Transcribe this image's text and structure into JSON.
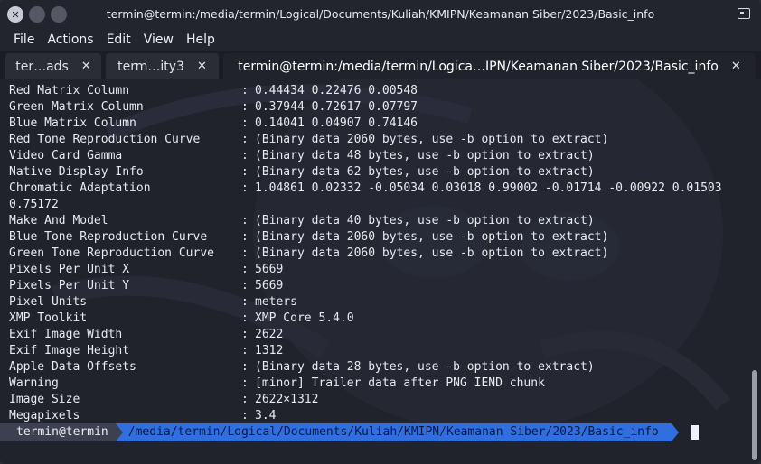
{
  "window": {
    "title": "termin@termin:/media/termin/Logical/Documents/Kuliah/KMIPN/Keamanan Siber/2023/Basic_info"
  },
  "menu": [
    "File",
    "Actions",
    "Edit",
    "View",
    "Help"
  ],
  "tabs": [
    {
      "label": "ter…ads",
      "close": "✕"
    },
    {
      "label": "term…ity3",
      "close": "✕"
    },
    {
      "label": "termin@termin:/media/termin/Logica…IPN/Keamanan Siber/2023/Basic_info",
      "close": "✕"
    }
  ],
  "output": [
    {
      "key": "Red Matrix Column",
      "value": "0.44434 0.22476 0.00548"
    },
    {
      "key": "Green Matrix Column",
      "value": "0.37944 0.72617 0.07797"
    },
    {
      "key": "Blue Matrix Column",
      "value": "0.14041 0.04907 0.74146"
    },
    {
      "key": "Red Tone Reproduction Curve",
      "value": "(Binary data 2060 bytes, use -b option to extract)"
    },
    {
      "key": "Video Card Gamma",
      "value": "(Binary data 48 bytes, use -b option to extract)"
    },
    {
      "key": "Native Display Info",
      "value": "(Binary data 62 bytes, use -b option to extract)"
    },
    {
      "key": "Chromatic Adaptation",
      "value": "1.04861 0.02332 -0.05034 0.03018 0.99002 -0.01714 -0.00922 0.01503"
    },
    {
      "key": "0.75172",
      "value": "",
      "wrap": true
    },
    {
      "key": "Make And Model",
      "value": "(Binary data 40 bytes, use -b option to extract)"
    },
    {
      "key": "Blue Tone Reproduction Curve",
      "value": "(Binary data 2060 bytes, use -b option to extract)"
    },
    {
      "key": "Green Tone Reproduction Curve",
      "value": "(Binary data 2060 bytes, use -b option to extract)"
    },
    {
      "key": "Pixels Per Unit X",
      "value": "5669"
    },
    {
      "key": "Pixels Per Unit Y",
      "value": "5669"
    },
    {
      "key": "Pixel Units",
      "value": "meters"
    },
    {
      "key": "XMP Toolkit",
      "value": "XMP Core 5.4.0"
    },
    {
      "key": "Exif Image Width",
      "value": "2622"
    },
    {
      "key": "Exif Image Height",
      "value": "1312"
    },
    {
      "key": "Apple Data Offsets",
      "value": "(Binary data 28 bytes, use -b option to extract)"
    },
    {
      "key": "Warning",
      "value": "[minor] Trailer data after PNG IEND chunk"
    },
    {
      "key": "Image Size",
      "value": "2622×1312"
    },
    {
      "key": "Megapixels",
      "value": "3.4"
    }
  ],
  "separator": ":",
  "prompt": {
    "user": "termin@termin",
    "path": "/media/termin/Logical/Documents/Kuliah/KMIPN/Keamanan Siber/2023/Basic_info"
  },
  "colors": {
    "terminal_bg": "#20222c",
    "prompt_path_bg": "#2f6fe0",
    "prompt_user_bg": "#3c4050"
  }
}
